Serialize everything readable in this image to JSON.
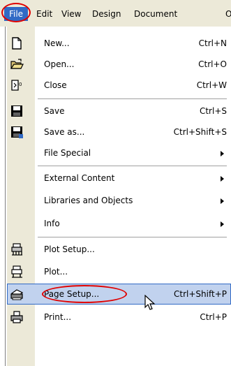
{
  "menubar": {
    "items": [
      "File",
      "Edit",
      "View",
      "Design",
      "Document",
      "O"
    ]
  },
  "file_menu": {
    "items": [
      {
        "label": "New...",
        "shortcut": "Ctrl+N",
        "icon": "new-document-icon"
      },
      {
        "label": "Open...",
        "shortcut": "Ctrl+O",
        "icon": "open-folder-icon"
      },
      {
        "label": "Close",
        "shortcut": "Ctrl+W",
        "icon": "close-document-icon"
      },
      {
        "label": "Save",
        "shortcut": "Ctrl+S",
        "icon": "save-disk-icon"
      },
      {
        "label": "Save as...",
        "shortcut": "Ctrl+Shift+S",
        "icon": "save-as-disk-icon"
      },
      {
        "label": "File Special",
        "submenu": true
      },
      {
        "label": "External Content",
        "submenu": true
      },
      {
        "label": "Libraries and Objects",
        "submenu": true
      },
      {
        "label": "Info",
        "submenu": true
      },
      {
        "label": "Plot Setup...",
        "icon": "plot-setup-icon"
      },
      {
        "label": "Plot...",
        "icon": "plotter-icon"
      },
      {
        "label": "Page Setup...",
        "shortcut": "Ctrl+Shift+P",
        "icon": "page-setup-icon",
        "highlighted": true
      },
      {
        "label": "Print...",
        "shortcut": "Ctrl+P",
        "icon": "printer-icon"
      }
    ]
  },
  "colors": {
    "menu_highlight": "#316ac5",
    "annotation_circle": "#e00000"
  }
}
